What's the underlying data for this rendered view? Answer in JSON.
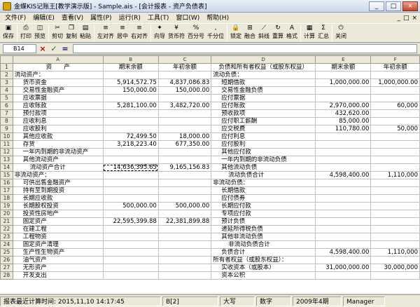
{
  "window": {
    "title": "金蝶KIS记账王[教学演示版] - Sample.ais - [会计报表 - 资产负债表]",
    "min": "_",
    "max": "□",
    "close": "×"
  },
  "menu": {
    "items": [
      "文件(F)",
      "编辑(E)",
      "查看(V)",
      "属性(P)",
      "运行(R)",
      "工具(T)",
      "窗口(W)",
      "帮助(H)"
    ],
    "right": [
      "_",
      "□",
      "×"
    ]
  },
  "toolbar": {
    "buttons": [
      {
        "label": "保存",
        "icon": "save-icon",
        "glyph": "▣"
      },
      {
        "label": "打印",
        "icon": "print-icon",
        "glyph": "⎙"
      },
      {
        "label": "预览",
        "icon": "preview-icon",
        "glyph": "◫"
      },
      {
        "label": "剪切",
        "icon": "cut-icon",
        "glyph": "✂"
      },
      {
        "label": "复制",
        "icon": "copy-icon",
        "glyph": "❐"
      },
      {
        "label": "粘贴",
        "icon": "paste-icon",
        "glyph": "▤"
      },
      {
        "label": "左对齐",
        "icon": "align-left-icon",
        "glyph": "≡"
      },
      {
        "label": "居中",
        "icon": "align-center-icon",
        "glyph": "≡"
      },
      {
        "label": "右对齐",
        "icon": "align-right-icon",
        "glyph": "≡"
      },
      {
        "label": "向导",
        "icon": "wizard-icon",
        "glyph": "✦"
      },
      {
        "label": "货币符",
        "icon": "currency-icon",
        "glyph": "¥"
      },
      {
        "label": "百分号",
        "icon": "percent-icon",
        "glyph": "%"
      },
      {
        "label": "千分位",
        "icon": "thousands-icon",
        "glyph": ","
      },
      {
        "label": "锁定",
        "icon": "lock-icon",
        "glyph": "🔒"
      },
      {
        "label": "融合",
        "icon": "merge-icon",
        "glyph": "⊞"
      },
      {
        "label": "斜线",
        "icon": "diagonal-icon",
        "glyph": "⟋"
      },
      {
        "label": "重算",
        "icon": "recalc-icon",
        "glyph": "↻"
      },
      {
        "label": "格式",
        "icon": "format-icon",
        "glyph": "A"
      },
      {
        "label": "计算",
        "icon": "calculate-icon",
        "glyph": "▦"
      },
      {
        "label": "汇总",
        "icon": "summary-icon",
        "glyph": "Σ"
      },
      {
        "label": "关闭",
        "icon": "close-icon",
        "glyph": "⏻"
      }
    ]
  },
  "formula": {
    "cell_ref": "B14",
    "cancel": "×",
    "accept": "✓",
    "fx": "="
  },
  "sheet": {
    "columns": [
      "",
      "A",
      "B",
      "C",
      "D",
      "E",
      "F"
    ],
    "rows": [
      {
        "n": "1",
        "a": "资　　产",
        "b": "期末余额",
        "c": "年初余额",
        "d": "负债和所有者权益（或股东权益）",
        "e": "期末余额",
        "f": "年初余额"
      },
      {
        "n": "2",
        "a": "流动资产：",
        "b": "",
        "c": "",
        "d": "流动负债：",
        "e": "",
        "f": ""
      },
      {
        "n": "3",
        "a": "货币资金",
        "b": "5,914,572.75",
        "c": "4,837,086.83",
        "d": "短期借款",
        "e": "1,000,000.00",
        "f": "1,000,000.00"
      },
      {
        "n": "4",
        "a": "交易性金融资产",
        "b": "150,000.00",
        "c": "150,000.00",
        "d": "交易性金融负债",
        "e": "",
        "f": ""
      },
      {
        "n": "5",
        "a": "应收票据",
        "b": "",
        "c": "",
        "d": "应付票据",
        "e": "",
        "f": ""
      },
      {
        "n": "6",
        "a": "应收账款",
        "b": "5,281,100.00",
        "c": "3,482,720.00",
        "d": "应付账款",
        "e": "2,970,000.00",
        "f": "60,000"
      },
      {
        "n": "7",
        "a": "预付款项",
        "b": "",
        "c": "",
        "d": "预收款项",
        "e": "432,620.00",
        "f": ""
      },
      {
        "n": "8",
        "a": "应收利息",
        "b": "",
        "c": "",
        "d": "应付职工薪酬",
        "e": "85,000.00",
        "f": ""
      },
      {
        "n": "9",
        "a": "应收股利",
        "b": "",
        "c": "",
        "d": "应交税费",
        "e": "110,780.00",
        "f": "50,000"
      },
      {
        "n": "10",
        "a": "其他应收款",
        "b": "72,499.50",
        "c": "18,000.00",
        "d": "应付利息",
        "e": "",
        "f": ""
      },
      {
        "n": "11",
        "a": "存货",
        "b": "3,218,223.40",
        "c": "677,350.00",
        "d": "应付股利",
        "e": "",
        "f": ""
      },
      {
        "n": "12",
        "a": "一年内到期的非流动资产",
        "b": "",
        "c": "",
        "d": "其他应付款",
        "e": "",
        "f": ""
      },
      {
        "n": "13",
        "a": "其他流动资产",
        "b": "",
        "c": "",
        "d": "一年内到期的非流动负债",
        "e": "",
        "f": ""
      },
      {
        "n": "14",
        "a": "流动资产合计",
        "b": "14,636,395.65",
        "c": "9,165,156.83",
        "d": "其他流动负债",
        "e": "",
        "f": ""
      },
      {
        "n": "15",
        "a": "非流动资产：",
        "b": "",
        "c": "",
        "d": "流动负债合计",
        "e": "4,598,400.00",
        "f": "1,110,000"
      },
      {
        "n": "16",
        "a": "可供出售金融资产",
        "b": "",
        "c": "",
        "d": "非流动负债：",
        "e": "",
        "f": ""
      },
      {
        "n": "17",
        "a": "持有至到期投资",
        "b": "",
        "c": "",
        "d": "长期借款",
        "e": "",
        "f": ""
      },
      {
        "n": "18",
        "a": "长期应收款",
        "b": "",
        "c": "",
        "d": "应付债券",
        "e": "",
        "f": ""
      },
      {
        "n": "19",
        "a": "长期股权投资",
        "b": "500,000.00",
        "c": "500,000.00",
        "d": "长期应付款",
        "e": "",
        "f": ""
      },
      {
        "n": "20",
        "a": "投资性房地产",
        "b": "",
        "c": "",
        "d": "专项应付款",
        "e": "",
        "f": ""
      },
      {
        "n": "21",
        "a": "固定资产",
        "b": "22,595,399.88",
        "c": "22,381,899.88",
        "d": "预计负债",
        "e": "",
        "f": ""
      },
      {
        "n": "22",
        "a": "在建工程",
        "b": "",
        "c": "",
        "d": "递延所得税负债",
        "e": "",
        "f": ""
      },
      {
        "n": "23",
        "a": "工程物资",
        "b": "",
        "c": "",
        "d": "其他非流动负债",
        "e": "",
        "f": ""
      },
      {
        "n": "24",
        "a": "固定资产清理",
        "b": "",
        "c": "",
        "d": "非流动负债合计",
        "e": "",
        "f": ""
      },
      {
        "n": "25",
        "a": "生产性生物资产",
        "b": "",
        "c": "",
        "d": "负债合计",
        "e": "4,598,400.00",
        "f": "1,110,000"
      },
      {
        "n": "26",
        "a": "油气资产",
        "b": "",
        "c": "",
        "d": "所有者权益（或股东权益）：",
        "e": "",
        "f": ""
      },
      {
        "n": "27",
        "a": "无形资产",
        "b": "",
        "c": "",
        "d": "实收资本（或股本）",
        "e": "31,000,000.00",
        "f": "30,000,000"
      },
      {
        "n": "28",
        "a": "开发支出",
        "b": "",
        "c": "",
        "d": "资本公积",
        "e": "",
        "f": ""
      }
    ]
  },
  "status": {
    "calc_time": "报表最近计算时间: 2015,11,10 14:17:45",
    "cell": "B[2]",
    "caps": "大写",
    "numlock": "数字",
    "period": "2009年4期",
    "user": "Manager"
  }
}
